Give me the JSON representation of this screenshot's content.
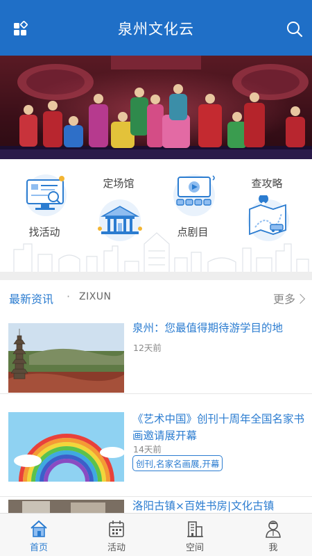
{
  "header": {
    "title": "泉州文化云",
    "menu_icon": "grid-menu-icon",
    "search_icon": "search-icon"
  },
  "features": [
    {
      "label": "找活动",
      "icon": "computer-search-icon"
    },
    {
      "label": "定场馆",
      "icon": "venue-building-icon"
    },
    {
      "label": "点剧目",
      "icon": "theater-screen-icon"
    },
    {
      "label": "查攻略",
      "icon": "map-route-icon"
    }
  ],
  "news": {
    "title": "最新资讯",
    "separator": "·",
    "subtitle": "ZIXUN",
    "more_label": "更多",
    "items": [
      {
        "title": "泉州：您最值得期待游学目的地",
        "time": "12天前",
        "tag": ""
      },
      {
        "title": "《艺术中国》创刊十周年全国名家书画邀请展开幕",
        "time": "14天前",
        "tag": "创刊,名家名画展,开幕"
      },
      {
        "title": "洛阳古镇×百姓书房|文化古镇",
        "time": "",
        "tag": ""
      }
    ]
  },
  "tabs": [
    {
      "label": "首页",
      "icon": "home-icon",
      "active": true
    },
    {
      "label": "活动",
      "icon": "calendar-icon",
      "active": false
    },
    {
      "label": "空间",
      "icon": "building-icon",
      "active": false
    },
    {
      "label": "我",
      "icon": "user-icon",
      "active": false
    }
  ],
  "colors": {
    "primary": "#1f6fc7",
    "accent": "#2b7cd0"
  }
}
